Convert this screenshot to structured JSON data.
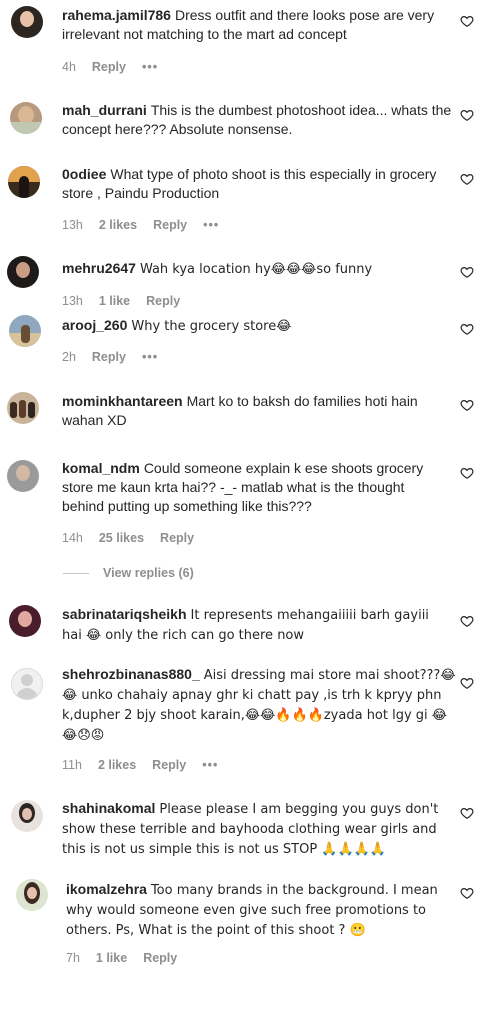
{
  "comments": [
    {
      "username": "rahema.jamil786",
      "text": "Dress outfit and there looks pose are very irrelevant not matching to the mart ad concept",
      "time": "4h",
      "likes": "",
      "reply": "Reply",
      "more": "•••"
    },
    {
      "username": "mah_durrani",
      "text": "This is the dumbest photoshoot idea... whats the concept here??? Absolute nonsense.",
      "time": "",
      "likes": "",
      "reply": "",
      "more": ""
    },
    {
      "username": "0odiee",
      "text": "What type of photo shoot is this especially in grocery store , Paindu Production",
      "time": "13h",
      "likes": "2 likes",
      "reply": "Reply",
      "more": "•••"
    },
    {
      "username": "mehru2647",
      "text": "Wah kya location hy😂😂😂so funny",
      "time": "13h",
      "likes": "1 like",
      "reply": "Reply",
      "more": ""
    },
    {
      "username": "arooj_260",
      "text": "Why the grocery store😂",
      "time": "2h",
      "likes": "",
      "reply": "Reply",
      "more": "•••"
    },
    {
      "username": "mominkhantareen",
      "text": "Mart ko to baksh do families hoti hain wahan XD",
      "time": "",
      "likes": "",
      "reply": "",
      "more": ""
    },
    {
      "username": "komal_ndm",
      "text": "Could someone explain k ese shoots grocery store me kaun krta hai?? -_- matlab what is the thought behind putting up something like this???",
      "time": "14h",
      "likes": "25 likes",
      "reply": "Reply",
      "more": "",
      "view_replies": "View replies (6)"
    },
    {
      "username": "sabrinatariqsheikh",
      "text": "It represents mehangaiiiii barh gayiii hai 😂 only the rich can go there now",
      "time": "",
      "likes": "",
      "reply": "",
      "more": ""
    },
    {
      "username": "shehrozbinanas880_",
      "text": "Aisi dressing mai store mai shoot???😂😂 unko chahaiy apnay ghr ki chatt pay ,is trh k kpryy phn k,dupher 2 bjy shoot karain,😂😂🔥🔥🔥zyada hot lgy gi 😂😂😞😡",
      "time": "11h",
      "likes": "2 likes",
      "reply": "Reply",
      "more": "•••"
    },
    {
      "username": "shahinakomal",
      "text": "Please please I am begging you guys don't show these terrible and bayhooda clothing wear girls and this is not us simple this is not us STOP 🙏🙏🙏🙏",
      "time": "",
      "likes": "",
      "reply": "",
      "more": ""
    },
    {
      "username": "ikomalzehra",
      "text": "Too many brands in the background. I mean why would someone even give such free promotions to others. Ps, What is the point of this shoot ? 😬",
      "time": "7h",
      "likes": "1 like",
      "reply": "Reply",
      "more": ""
    }
  ],
  "colors": {
    "text": "#262626",
    "meta": "#8e8e8e",
    "heart": "#262626"
  },
  "icons": {
    "like": "heart-outline-icon",
    "more": "more-horizontal-icon"
  }
}
